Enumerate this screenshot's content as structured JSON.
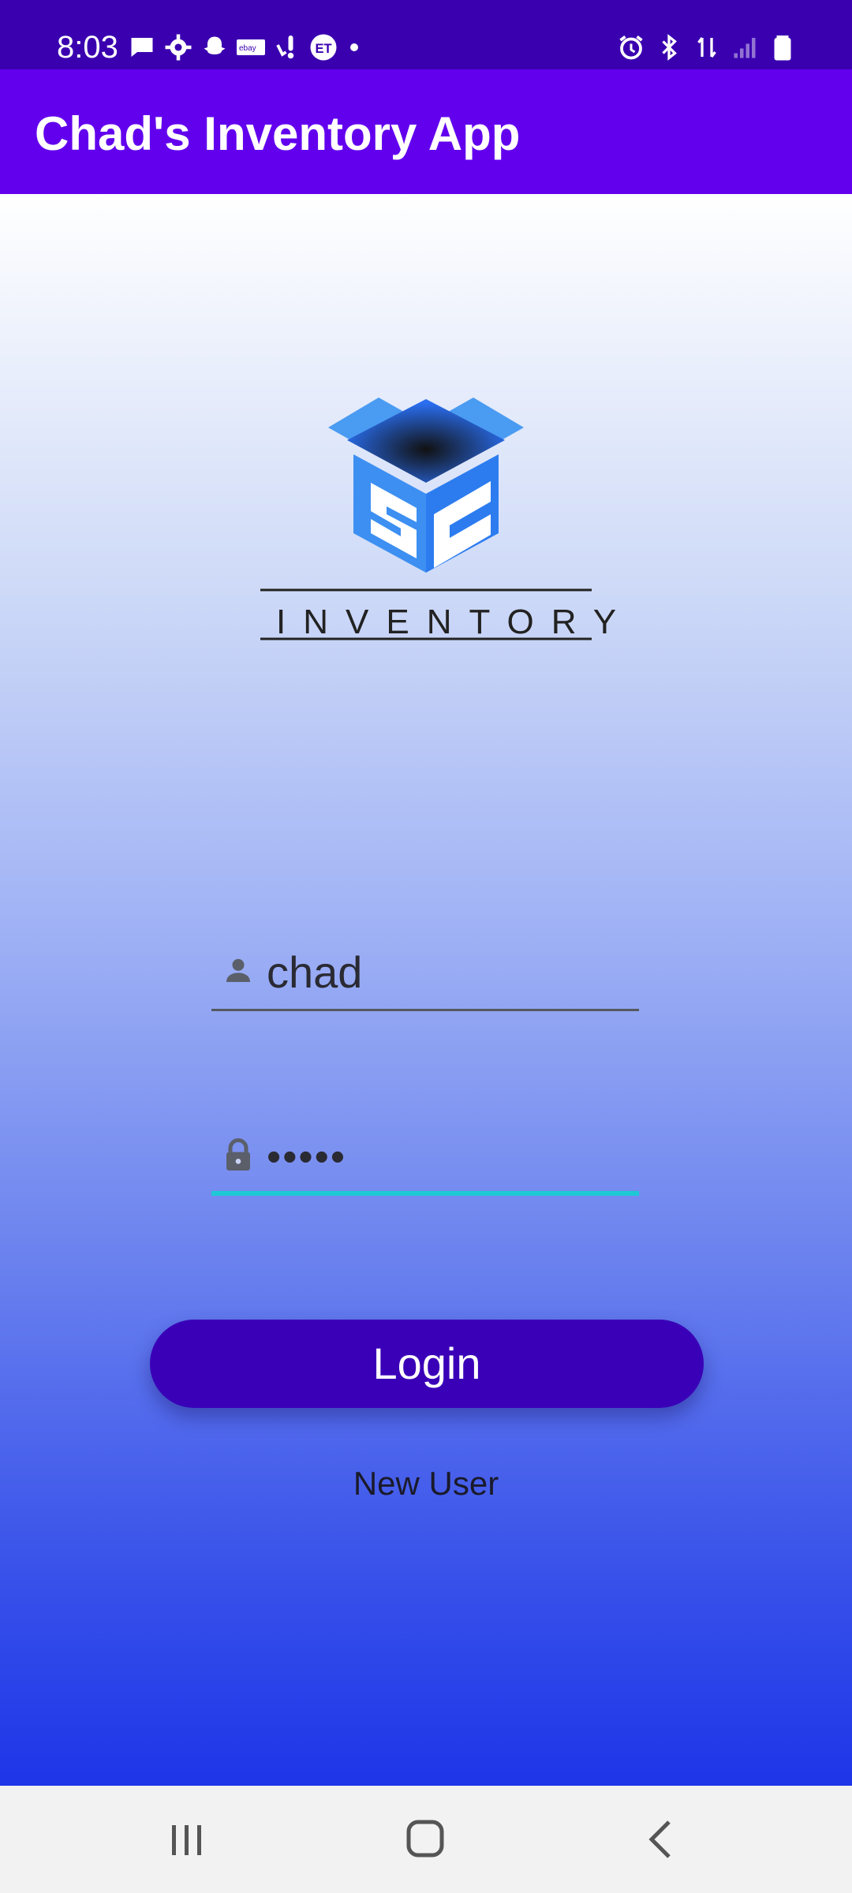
{
  "status_bar": {
    "time": "8:03",
    "icons_left": [
      "chat-icon",
      "gear-icon",
      "snapchat-icon",
      "ebay-icon",
      "notification-icon",
      "et-icon",
      "dot-icon"
    ],
    "icons_right": [
      "alarm-icon",
      "bluetooth-icon",
      "data-icon",
      "signal-icon",
      "battery-icon"
    ]
  },
  "app_bar": {
    "title": "Chad's Inventory App"
  },
  "logo": {
    "brand_text": "INVENTORY",
    "monogram": "SC"
  },
  "login_form": {
    "username_value": "chad",
    "password_value": "•••••",
    "login_label": "Login",
    "new_user_label": "New User"
  },
  "colors": {
    "status_bar": "#3A00B0",
    "app_bar": "#6200EE",
    "button": "#3A00B8",
    "focus_underline": "#1EC8D4"
  }
}
